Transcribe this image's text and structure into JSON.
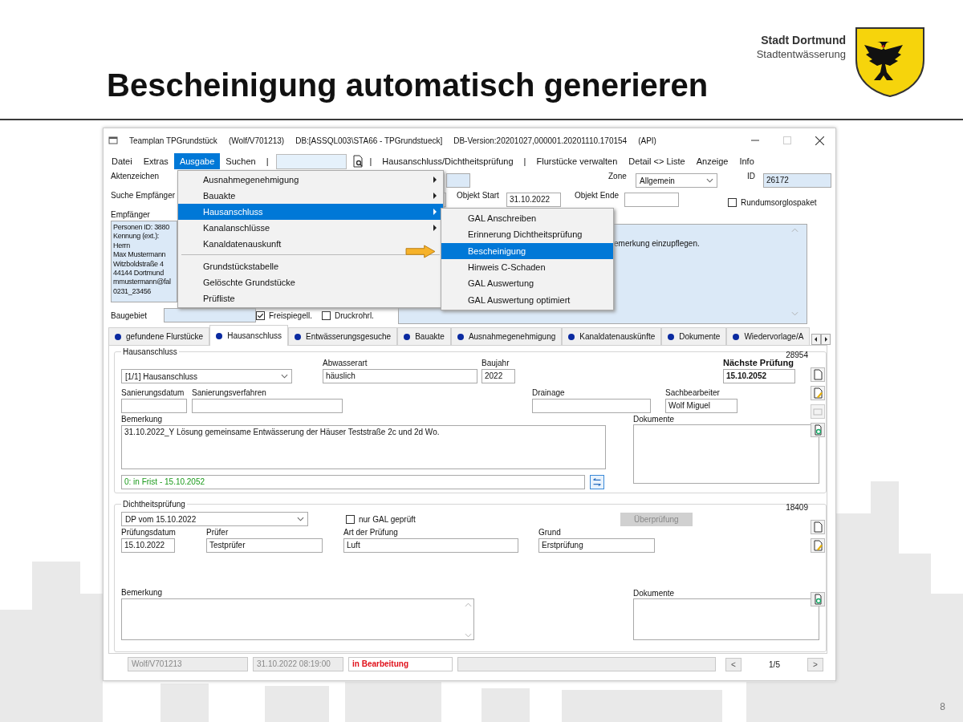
{
  "slide": {
    "title": "Bescheinigung automatisch generieren",
    "org_name": "Stadt Dortmund",
    "org_subtitle": "Stadtentwässerung",
    "page_number": "8"
  },
  "window": {
    "app": "Teamplan TPGrundstück",
    "user": "(Wolf/V701213)",
    "database": "DB:[ASSQL003\\STA66 - TPGrundstueck]",
    "version": "DB-Version:20201027,000001.20201110.170154",
    "mode": "(API)"
  },
  "menubar": [
    {
      "kind": "menu",
      "label": "Datei",
      "selected": false
    },
    {
      "kind": "menu",
      "label": "Extras",
      "selected": false
    },
    {
      "kind": "menu",
      "label": "Ausgabe",
      "selected": true
    },
    {
      "kind": "menu",
      "label": "Suchen",
      "selected": false
    },
    {
      "kind": "separator",
      "label": "|"
    },
    {
      "kind": "search"
    },
    {
      "kind": "search_button"
    },
    {
      "kind": "separator",
      "label": "|"
    },
    {
      "kind": "menu",
      "label": "Hausanschluss/Dichtheitsprüfung",
      "selected": false
    },
    {
      "kind": "separator",
      "label": "|"
    },
    {
      "kind": "menu",
      "label": "Flurstücke verwalten",
      "selected": false
    },
    {
      "kind": "menu",
      "label": "Detail <> Liste",
      "selected": false
    },
    {
      "kind": "menu",
      "label": "Anzeige",
      "selected": false
    },
    {
      "kind": "menu",
      "label": "Info",
      "selected": false
    }
  ],
  "dropdown": [
    {
      "kind": "item",
      "label": "Ausnahmegenehmigung",
      "submenu": true,
      "selected": false
    },
    {
      "kind": "item",
      "label": "Bauakte",
      "submenu": true,
      "selected": false
    },
    {
      "kind": "item",
      "label": "Hausanschluss",
      "submenu": true,
      "selected": true
    },
    {
      "kind": "item",
      "label": "Kanalanschlüsse",
      "submenu": true,
      "selected": false
    },
    {
      "kind": "item",
      "label": "Kanaldatenauskunft",
      "submenu": false,
      "selected": false
    },
    {
      "kind": "separator"
    },
    {
      "kind": "item",
      "label": "Grundstückstabelle",
      "submenu": false,
      "selected": false
    },
    {
      "kind": "item",
      "label": "Gelöschte Grundstücke",
      "submenu": false,
      "selected": false
    },
    {
      "kind": "item",
      "label": "Prüfliste",
      "submenu": false,
      "selected": false
    }
  ],
  "submenu": [
    {
      "label": "GAL Anschreiben",
      "selected": false,
      "pointer": false
    },
    {
      "label": "Erinnerung Dichtheitsprüfung",
      "selected": false,
      "pointer": false
    },
    {
      "label": "Bescheinigung",
      "selected": true,
      "pointer": true
    },
    {
      "label": "Hinweis C-Schaden",
      "selected": false,
      "pointer": false
    },
    {
      "label": "GAL Auswertung",
      "selected": false,
      "pointer": false
    },
    {
      "label": "GAL Auswertung optimiert",
      "selected": false,
      "pointer": false
    }
  ],
  "header": {
    "aktenzeichen_label": "Aktenzeichen",
    "zone_label": "Zone",
    "zone": "Allgemein",
    "id_label": "ID",
    "id": "26172",
    "suche_label": "Suche Empfänger",
    "objekt_start_label": "Objekt Start",
    "objekt_start": "31.10.2022",
    "objekt_ende_label": "Objekt Ende",
    "rundum": {
      "label": "Rundumsorglospaket",
      "checked": false
    },
    "empfaenger_label": "Empfänger",
    "empfaenger_lines": [
      "Personen ID: 3880",
      "Kennung (ext.):",
      "Herrn",
      "Max Mustermann",
      "Witzboldstraße 4",
      "44144 Dortmund",
      "mmustermann@fal",
      "0231_23456"
    ],
    "notiz": "emerkung einzupflegen.",
    "baugebiet_label": "Baugebiet",
    "checks": [
      {
        "label": "Freispiegell.",
        "checked": true
      },
      {
        "label": "Druckrohrl.",
        "checked": false
      }
    ]
  },
  "tabs": [
    {
      "label": "gefundene Flurstücke",
      "selected": false
    },
    {
      "label": "Hausanschluss",
      "selected": true
    },
    {
      "label": "Entwässerungsgesuche",
      "selected": false
    },
    {
      "label": "Bauakte",
      "selected": false
    },
    {
      "label": "Ausnahmegenehmigung",
      "selected": false
    },
    {
      "label": "Kanaldatenauskünfte",
      "selected": false
    },
    {
      "label": "Dokumente",
      "selected": false
    },
    {
      "label": "Wiedervorlage/A",
      "selected": false
    }
  ],
  "hausanschluss": {
    "legend": "Hausanschluss",
    "record_id": "28954",
    "selector": "[1/1]  Hausanschluss",
    "abwasserart": {
      "label": "Abwasserart",
      "value": "häuslich"
    },
    "baujahr": {
      "label": "Baujahr",
      "value": "2022"
    },
    "naechste_pruefung": {
      "label": "Nächste Prüfung",
      "value": "15.10.2052"
    },
    "sanierungsdatum": {
      "label": "Sanierungsdatum"
    },
    "sanierungsverfahren": {
      "label": "Sanierungsverfahren"
    },
    "drainage": {
      "label": "Drainage"
    },
    "sachbearbeiter": {
      "label": "Sachbearbeiter",
      "value": "Wolf  Miguel"
    },
    "bemerkung": {
      "label": "Bemerkung",
      "value": "31.10.2022_Y Lösung gemeinsame Entwässerung der Häuser Teststraße 2c und 2d Wo."
    },
    "dokumente_label": "Dokumente",
    "frist_status": "0: in Frist - 15.10.2052"
  },
  "dichtheit": {
    "legend": "Dichtheitsprüfung",
    "record_id": "18409",
    "selector": "DP vom 15.10.2022",
    "nur_gal": {
      "label": "nur GAL geprüft",
      "checked": false
    },
    "ueberpruefung_button": {
      "label": "Überprüfung",
      "disabled": true
    },
    "pruefungsdatum": {
      "label": "Prüfungsdatum",
      "value": "15.10.2022"
    },
    "pruefer": {
      "label": "Prüfer",
      "value": "Testprüfer"
    },
    "art": {
      "label": "Art der Prüfung",
      "value": "Luft"
    },
    "grund": {
      "label": "Grund",
      "value": "Erstprüfung"
    },
    "bemerkung_label": "Bemerkung",
    "dokumente_label": "Dokumente"
  },
  "status_bar": {
    "user": "Wolf/V701213",
    "timestamp": "31.10.2022 08:19:00",
    "state": "in Bearbeitung",
    "prev": "<",
    "page": "1/5",
    "next": ">"
  }
}
